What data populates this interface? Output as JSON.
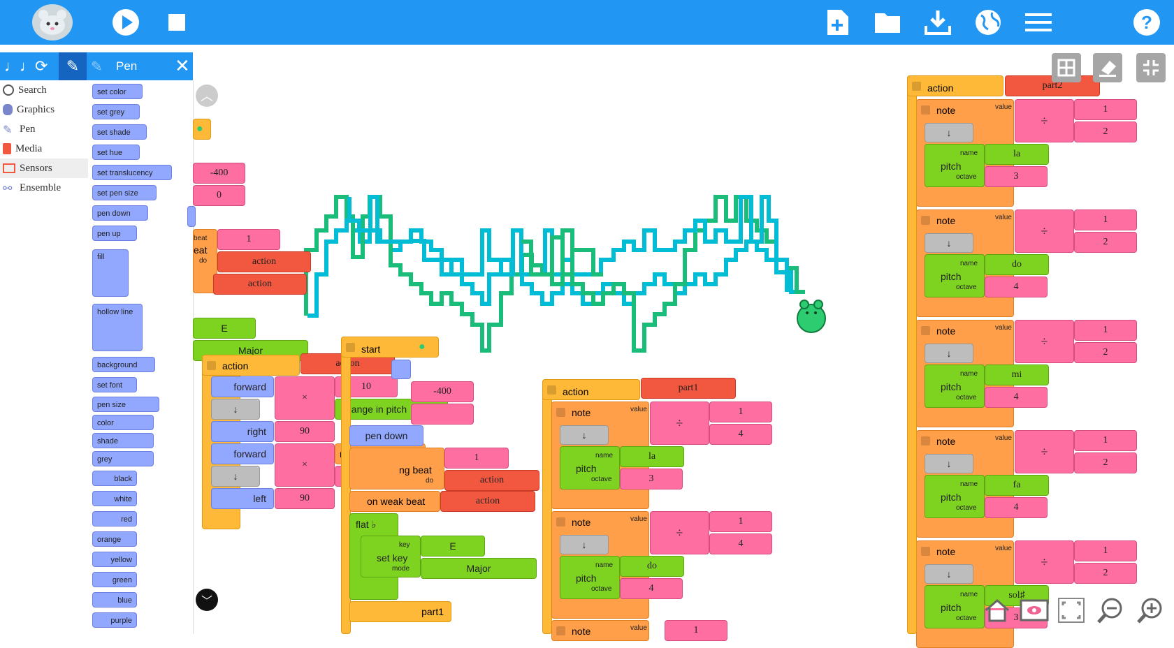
{
  "toolbar": {
    "logo": "mouse-logo-icon",
    "run": "play-icon",
    "stop": "stop-icon",
    "new": "new-file-icon",
    "open": "folder-icon",
    "save": "download-icon",
    "language": "globe-icon",
    "menu": "hamburger-icon",
    "help": "help-icon"
  },
  "palette": {
    "title": "Pen",
    "categories": [
      "Search",
      "Graphics",
      "Pen",
      "Media",
      "Sensors",
      "Ensemble"
    ],
    "blocks": [
      "set color",
      "set grey",
      "set shade",
      "set hue",
      "set translucency",
      "set pen size",
      "pen down",
      "pen up",
      "fill",
      "hollow line",
      "background",
      "set font",
      "pen size",
      "color",
      "shade",
      "grey",
      "black",
      "white",
      "red",
      "orange",
      "yellow",
      "green",
      "blue",
      "purple"
    ]
  },
  "left_stack": {
    "v1": "-400",
    "v2": "0",
    "beat_val": "1",
    "beat_label": "beat",
    "eat_label": "eat",
    "do_label": "do",
    "action1": "action",
    "action2": "action",
    "key": "E",
    "mode": "Major"
  },
  "stack_action": {
    "label": "action",
    "name": "action",
    "forward1": "forward",
    "mult": "×",
    "ten": "10",
    "pitch_change": "change in pitch",
    "down1": "↓",
    "right": "right",
    "ninety1": "90",
    "forward2": "forward",
    "note_value": "note value",
    "forty": "40",
    "down2": "↓",
    "left": "left",
    "ninety2": "90"
  },
  "stack_start": {
    "label": "start",
    "neg400": "-400",
    "pen_down": "pen down",
    "beat_val": "1",
    "strong_beat": "ng beat",
    "do_label": "do",
    "action_a": "action",
    "weak_beat": "on weak beat",
    "action_b": "action",
    "flat": "flat ♭",
    "set_key": "set key",
    "key_label": "key",
    "mode_label": "mode",
    "key": "E",
    "mode": "Major",
    "part1": "part1"
  },
  "stack_part1": {
    "label": "action",
    "name": "part1",
    "notes": [
      {
        "label": "note",
        "value_label": "value",
        "num": "1",
        "den": "4",
        "name_label": "name",
        "pitch": "pitch",
        "octave_label": "octave",
        "solfege": "la",
        "octave": "3",
        "down": "↓",
        "div": "÷"
      },
      {
        "label": "note",
        "value_label": "value",
        "num": "1",
        "den": "4",
        "name_label": "name",
        "pitch": "pitch",
        "octave_label": "octave",
        "solfege": "do",
        "octave": "4",
        "down": "↓",
        "div": "÷"
      },
      {
        "label": "note",
        "value_label": "value",
        "num": "1"
      }
    ]
  },
  "stack_part2": {
    "label": "action",
    "name": "part2",
    "notes": [
      {
        "label": "note",
        "value_label": "value",
        "num": "1",
        "den": "2",
        "name_label": "name",
        "pitch": "pitch",
        "octave_label": "octave",
        "solfege": "la",
        "octave": "3",
        "down": "↓",
        "div": "÷"
      },
      {
        "label": "note",
        "value_label": "value",
        "num": "1",
        "den": "2",
        "name_label": "name",
        "pitch": "pitch",
        "octave_label": "octave",
        "solfege": "do",
        "octave": "4",
        "down": "↓",
        "div": "÷"
      },
      {
        "label": "note",
        "value_label": "value",
        "num": "1",
        "den": "2",
        "name_label": "name",
        "pitch": "pitch",
        "octave_label": "octave",
        "solfege": "mi",
        "octave": "4",
        "down": "↓",
        "div": "÷"
      },
      {
        "label": "note",
        "value_label": "value",
        "num": "1",
        "den": "2",
        "name_label": "name",
        "pitch": "pitch",
        "octave_label": "octave",
        "solfege": "fa",
        "octave": "4",
        "down": "↓",
        "div": "÷"
      },
      {
        "label": "note",
        "value_label": "value",
        "num": "1",
        "den": "2",
        "name_label": "name",
        "pitch": "pitch",
        "octave_label": "octave",
        "solfege": "sol♯",
        "octave": "3",
        "down": "↓",
        "div": "÷"
      }
    ]
  },
  "canvas_controls": [
    "grid-icon",
    "eraser-icon",
    "collapse-icon"
  ],
  "bottom_controls": [
    "home-icon",
    "eye-icon",
    "fullscreen-icon",
    "zoom-out-icon",
    "zoom-in-icon"
  ],
  "colors": {
    "toolbar": "#2196f3",
    "trace_cyan": "#00bcd4",
    "trace_green": "#1abc7a"
  }
}
